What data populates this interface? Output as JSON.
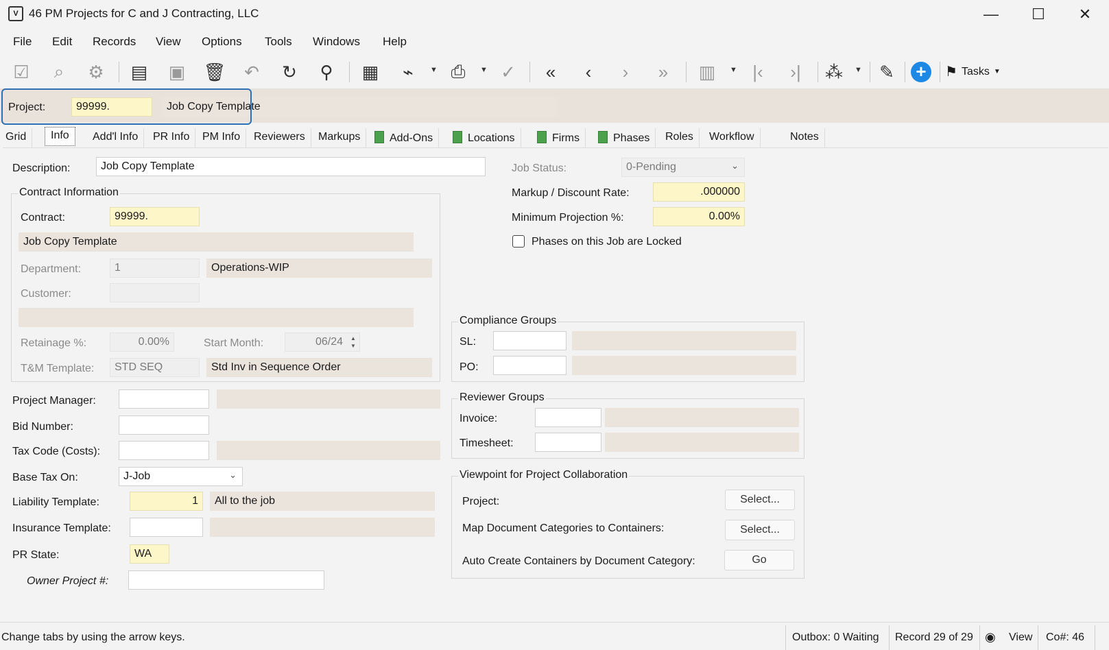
{
  "window": {
    "title": "46 PM Projects for C and J Contracting, LLC",
    "app_icon_text": "V"
  },
  "menu": [
    "File",
    "Edit",
    "Records",
    "View",
    "Options",
    "Tools",
    "Windows",
    "Help"
  ],
  "toolbar": {
    "tasks_label": "Tasks"
  },
  "project": {
    "label": "Project:",
    "number": "99999.",
    "description": "Job Copy Template"
  },
  "tabs": [
    "Grid",
    "Info",
    "Add'l Info",
    "PR Info",
    "PM Info",
    "Reviewers",
    "Markups",
    "Add-Ons",
    "Locations",
    "Firms",
    "Phases",
    "Roles",
    "Workflow",
    "Notes"
  ],
  "active_tab": "Info",
  "info": {
    "description_label": "Description:",
    "description_value": "Job Copy Template",
    "job_status_label": "Job Status:",
    "job_status_value": "0-Pending",
    "markup_label": "Markup / Discount Rate:",
    "markup_value": ".000000",
    "min_projection_label": "Minimum Projection %:",
    "min_projection_value": "0.00%",
    "phases_locked_label": "Phases on this Job are Locked",
    "phases_locked_checked": false,
    "contract_group": {
      "title": "Contract Information",
      "contract_label": "Contract:",
      "contract_value": "99999.",
      "contract_desc": "Job Copy Template",
      "department_label": "Department:",
      "department_value": "1",
      "department_desc": "Operations-WIP",
      "customer_label": "Customer:",
      "customer_value": "",
      "retainage_label": "Retainage %:",
      "retainage_value": "0.00%",
      "start_month_label": "Start Month:",
      "start_month_value": "06/24",
      "tm_template_label": "T&M Template:",
      "tm_template_value": "STD SEQ",
      "tm_template_desc": "Std Inv in Sequence Order"
    },
    "project_manager_label": "Project Manager:",
    "bid_number_label": "Bid Number:",
    "tax_code_label": "Tax Code (Costs):",
    "base_tax_label": "Base Tax On:",
    "base_tax_value": "J-Job",
    "liability_label": "Liability Template:",
    "liability_value": "1",
    "liability_desc": "All to the job",
    "insurance_label": "Insurance Template:",
    "pr_state_label": "PR State:",
    "pr_state_value": "WA",
    "owner_project_label": "Owner Project #:",
    "compliance": {
      "title": "Compliance Groups",
      "sl_label": "SL:",
      "po_label": "PO:"
    },
    "reviewer": {
      "title": "Reviewer Groups",
      "invoice_label": "Invoice:",
      "timesheet_label": "Timesheet:"
    },
    "collab": {
      "title": "Viewpoint for Project Collaboration",
      "project_label": "Project:",
      "project_btn": "Select...",
      "map_label": "Map Document Categories to Containers:",
      "map_btn": "Select...",
      "auto_label": "Auto Create Containers by Document Category:",
      "auto_btn": "Go"
    }
  },
  "status": {
    "hint": "Change tabs by using the arrow keys.",
    "outbox": "Outbox: 0 Waiting",
    "record": "Record 29 of 29",
    "view": "View",
    "company": "Co#: 46"
  },
  "colors": {
    "highlight_border": "#2f6fb3",
    "yellow_field": "#fdf6c9",
    "tan_field": "#ebe4dd",
    "plus_icon": "#1e88e5"
  }
}
